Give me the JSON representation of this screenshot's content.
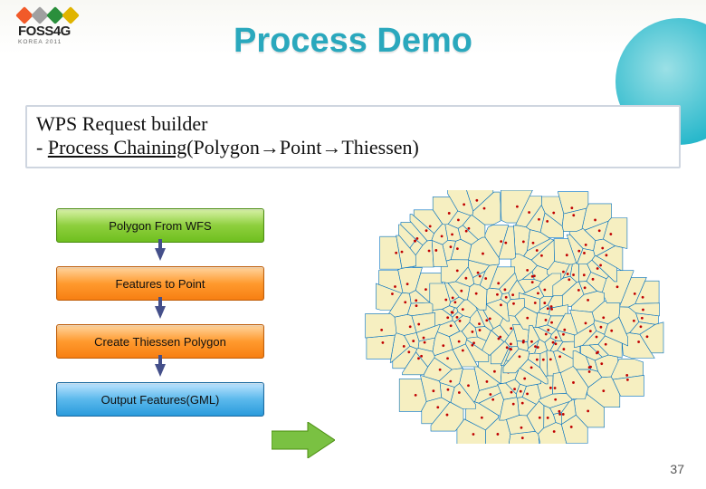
{
  "logo": {
    "text": "FOSS4G",
    "sub": "KOREA 2011",
    "dot_colors": [
      "#f15a29",
      "#a0a0a0",
      "#2a8f3c",
      "#e0b400"
    ]
  },
  "title": "Process Demo",
  "header": {
    "line1": "WPS Request builder",
    "dash": " - ",
    "chain_label": "Process Chaining",
    "chain_rest": "(Polygon→Point→Thiessen)"
  },
  "steps": [
    {
      "label": "Polygon From WFS",
      "style": "green"
    },
    {
      "label": "Features to Point",
      "style": "orange"
    },
    {
      "label": "Create Thiessen Polygon",
      "style": "orange"
    },
    {
      "label": "Output Features(GML)",
      "style": "blue"
    }
  ],
  "big_arrow_color": "#7ac142",
  "slide_number": "37",
  "thiessen_colors": {
    "fill": "#f6efc1",
    "stroke": "#0070c0",
    "seed": "#c00000"
  }
}
